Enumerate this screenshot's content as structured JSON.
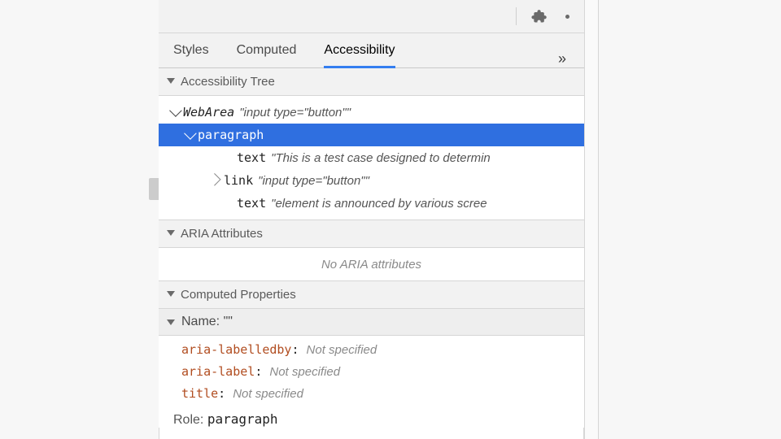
{
  "toolbar": {
    "overflow_glyph": "»"
  },
  "tabs": {
    "items": [
      {
        "label": "Styles",
        "id": "styles",
        "active": false
      },
      {
        "label": "Computed",
        "id": "computed",
        "active": false
      },
      {
        "label": "Accessibility",
        "id": "accessibility",
        "active": true
      }
    ]
  },
  "sections": {
    "tree_header": "Accessibility Tree",
    "aria_header": "ARIA Attributes",
    "computed_header": "Computed Properties",
    "name_label": "Name:",
    "name_value": "\"\"",
    "role_label": "Role:",
    "role_value": "paragraph"
  },
  "tree": {
    "root": {
      "role": "WebArea",
      "label": "\"input type=\"button\"\""
    },
    "selected": {
      "role": "paragraph"
    },
    "children": [
      {
        "role": "text",
        "label": "\"This is a test case designed to determin"
      },
      {
        "role": "link",
        "label": "\"input type=\"button\"\"",
        "expandable": true
      },
      {
        "role": "text",
        "label": "\"element is announced by various scree"
      }
    ]
  },
  "aria": {
    "empty_message": "No ARIA attributes"
  },
  "computed": {
    "props": [
      {
        "key": "aria-labelledby",
        "val": "Not specified"
      },
      {
        "key": "aria-label",
        "val": "Not specified"
      },
      {
        "key": "title",
        "val": "Not specified"
      }
    ]
  }
}
